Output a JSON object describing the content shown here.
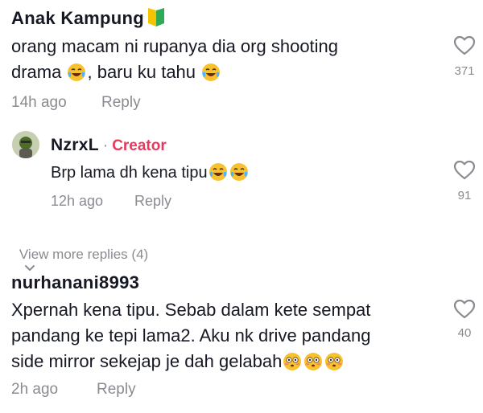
{
  "comments": [
    {
      "username": "Anak Kampung",
      "line1": "orang macam ni rupanya dia org shooting",
      "line2_part1": "drama ",
      "line2_part2": ", baru ku tahu ",
      "time": "14h ago",
      "reply_label": "Reply",
      "likes": "371",
      "badge_icon": "beginner-badge-icon"
    },
    {
      "username": "NzrxL",
      "separator": "·",
      "role": "Creator",
      "text": "Brp lama dh kena tipu",
      "time": "12h ago",
      "reply_label": "Reply",
      "likes": "91",
      "avatar_icon": "avatar"
    },
    {
      "username": "nurhanani8993",
      "line1": "Xpernah kena tipu. Sebab dalam kete sempat",
      "line2": "pandang ke tepi lama2. Aku nk drive pandang",
      "line3": "side mirror sekejap je dah gelabah",
      "time": "2h ago",
      "reply_label": "Reply",
      "likes": "40"
    }
  ],
  "view_more": {
    "label": "View more replies (4)",
    "icon": "chevron-down-icon"
  },
  "colors": {
    "creator": "#e8385d",
    "muted": "#8a8b91",
    "text": "#161823",
    "badge_yellow": "#f5c400",
    "badge_green": "#2faa55"
  }
}
